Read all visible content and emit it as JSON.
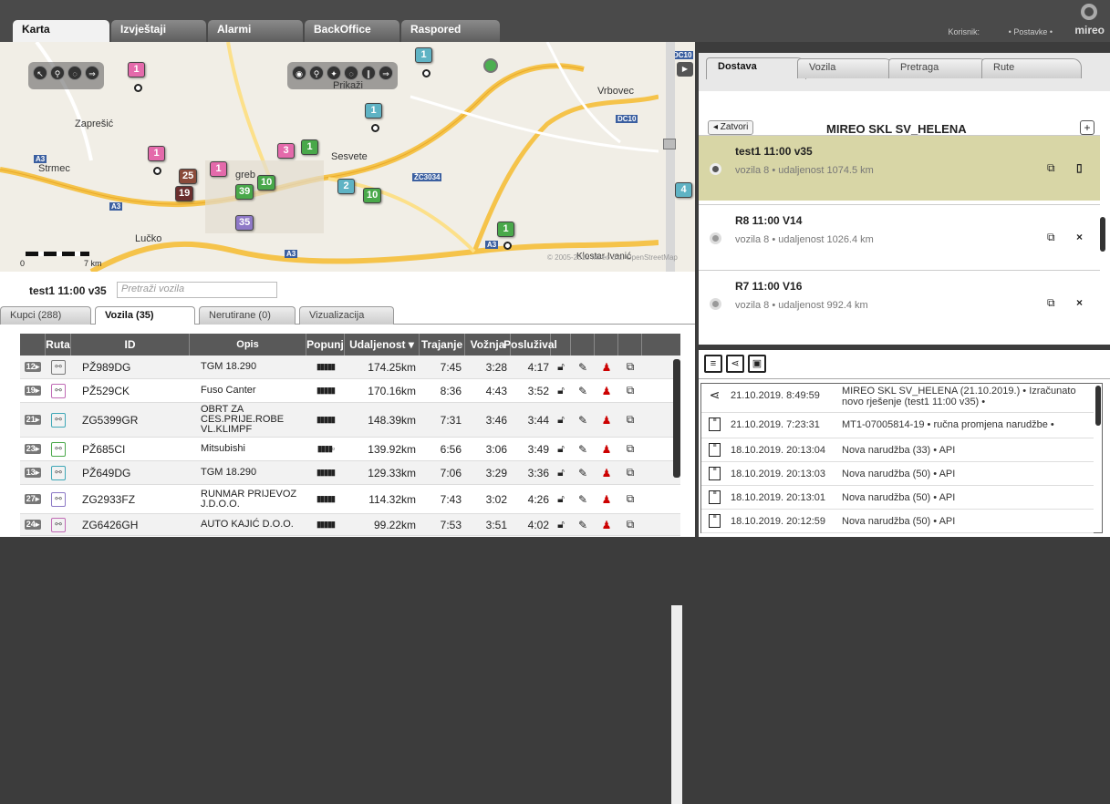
{
  "top_tabs": [
    "Karta",
    "Izvještaji",
    "Alarmi",
    "BackOffice",
    "Raspored"
  ],
  "user": {
    "label": "Korisnik:",
    "settings": "• Postavke •",
    "logo": "mireo"
  },
  "map": {
    "place_labels": [
      "Zaprešić",
      "Strmec",
      "Sesvete",
      "Vrbovec",
      "Lučko",
      "Klostar Ivanić",
      "greb"
    ],
    "road_labels": [
      "A3",
      "A3",
      "A3",
      "A3",
      "DC10",
      "ŽC3034",
      "DC10"
    ],
    "prikazi": "Prikaži",
    "scale_start": "0",
    "scale_end": "7 km",
    "copyright": "© 2005-2015 Mireo d.d. OpenStreetMap",
    "markers": [
      "1",
      "1",
      "1",
      "1",
      "3",
      "1",
      "25",
      "1",
      "19",
      "39",
      "10",
      "35",
      "2",
      "10",
      "1",
      "4"
    ]
  },
  "vehicles_panel": {
    "title": "test1 11:00 v35",
    "search_placeholder": "Pretraži vozila",
    "tabs": [
      "Kupci (288)",
      "Vozila (35)",
      "Nerutirane (0)",
      "Vizualizacija"
    ],
    "columns": [
      "",
      "Ruta",
      "ID",
      "Opis",
      "Popunj",
      "Udaljenost ▾",
      "Trajanje",
      "Vožnja",
      "Poslužival",
      "",
      "",
      "",
      ""
    ],
    "rows": [
      {
        "num": "12▸",
        "id": "PŽ989DG",
        "opis": "TGM 18.290",
        "fill": "▮▮▮▮▮",
        "dist": "174.25km",
        "traj": "7:45",
        "voznja": "3:28",
        "posl": "4:17"
      },
      {
        "num": "19▸",
        "id": "PŽ529CK",
        "opis": "Fuso Canter",
        "fill": "▮▮▮▮▮",
        "dist": "170.16km",
        "traj": "8:36",
        "voznja": "4:43",
        "posl": "3:52"
      },
      {
        "num": "21▸",
        "id": "ZG5399GR",
        "opis": "OBRT ZA CES.PRIJE.ROBE VL.KLIMPF",
        "fill": "▮▮▮▮▮",
        "dist": "148.39km",
        "traj": "7:31",
        "voznja": "3:46",
        "posl": "3:44"
      },
      {
        "num": "23▸",
        "id": "PŽ685CI",
        "opis": "Mitsubishi",
        "fill": "▮▮▮▮▫",
        "dist": "139.92km",
        "traj": "6:56",
        "voznja": "3:06",
        "posl": "3:49"
      },
      {
        "num": "13▸",
        "id": "PŽ649DG",
        "opis": "TGM 18.290",
        "fill": "▮▮▮▮▮",
        "dist": "129.33km",
        "traj": "7:06",
        "voznja": "3:29",
        "posl": "3:36"
      },
      {
        "num": "27▸",
        "id": "ZG2933FZ",
        "opis": "RUNMAR PRIJEVOZ J.D.O.O.",
        "fill": "▮▮▮▮▮",
        "dist": "114.32km",
        "traj": "7:43",
        "voznja": "3:02",
        "posl": "4:26"
      },
      {
        "num": "24▸",
        "id": "ZG6426GH",
        "opis": "AUTO KAJIĆ D.O.O.",
        "fill": "▮▮▮▮▮",
        "dist": "99.22km",
        "traj": "7:53",
        "voznja": "3:51",
        "posl": "4:02"
      }
    ]
  },
  "right_panel": {
    "tabs": [
      "Dostava",
      "Vozila",
      "Pretraga",
      "Rute"
    ],
    "close_label": "◂ Zatvori",
    "depot_title": "MIREO SKL SV_HELENA",
    "plus": "+",
    "routes": [
      {
        "title": "test1 11:00 v35",
        "sub": "vozila 8 • udaljenost 1074.5 km",
        "icon2": "▯"
      },
      {
        "title": "R8 11:00 V14",
        "sub": "vozila 8 • udaljenost 1026.4 km",
        "icon2": "×"
      },
      {
        "title": "R7 11:00 V16",
        "sub": "vozila 8 • udaljenost 992.4 km",
        "icon2": "×"
      }
    ],
    "log": [
      {
        "date": "21.10.2019. 8:49:59",
        "text": "MIREO SKL SV_HELENA (21.10.2019.) • Izračunato novo rješenje (test1 11:00 v35) •",
        "icon": "share-icon"
      },
      {
        "date": "21.10.2019. 7:23:31",
        "text": "MT1-07005814-19 • ručna promjena narudžbe •",
        "icon": "document-icon"
      },
      {
        "date": "18.10.2019. 20:13:04",
        "text": "Nova narudžba (33) • API",
        "icon": "document-icon"
      },
      {
        "date": "18.10.2019. 20:13:03",
        "text": "Nova narudžba (50) • API",
        "icon": "document-icon"
      },
      {
        "date": "18.10.2019. 20:13:01",
        "text": "Nova narudžba (50) • API",
        "icon": "document-icon"
      },
      {
        "date": "18.10.2019. 20:12:59",
        "text": "Nova narudžba (50) • API",
        "icon": "document-icon"
      }
    ]
  }
}
